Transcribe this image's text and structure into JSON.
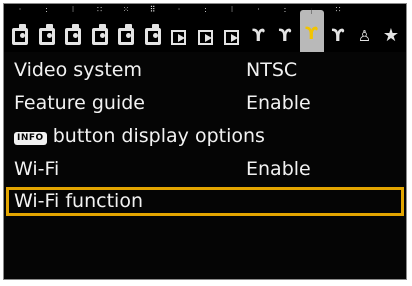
{
  "tabs": [
    {
      "icon": "shooting-icon",
      "dots": "·",
      "kind": "cam",
      "glyph": ""
    },
    {
      "icon": "shooting-icon",
      "dots": ":",
      "kind": "cam",
      "glyph": ""
    },
    {
      "icon": "shooting-icon",
      "dots": "⁝",
      "kind": "cam",
      "glyph": ""
    },
    {
      "icon": "shooting-icon",
      "dots": "∷",
      "kind": "cam",
      "glyph": ""
    },
    {
      "icon": "shooting-icon",
      "dots": "⁙",
      "kind": "cam",
      "glyph": ""
    },
    {
      "icon": "shooting-icon",
      "dots": "⠿",
      "kind": "cam",
      "glyph": ""
    },
    {
      "icon": "playback-icon",
      "dots": "·",
      "kind": "play",
      "glyph": ""
    },
    {
      "icon": "playback-icon",
      "dots": ":",
      "kind": "play",
      "glyph": ""
    },
    {
      "icon": "playback-icon",
      "dots": "⁝",
      "kind": "play",
      "glyph": ""
    },
    {
      "icon": "setup-icon",
      "dots": "·",
      "kind": "wrench",
      "glyph": "ϒ"
    },
    {
      "icon": "setup-icon",
      "dots": ":",
      "kind": "wrench",
      "glyph": "ϒ"
    },
    {
      "icon": "setup-icon",
      "dots": "⁝",
      "kind": "wrench",
      "glyph": "ϒ",
      "active": true
    },
    {
      "icon": "setup-icon",
      "dots": "∷",
      "kind": "wrench",
      "glyph": "ϒ"
    },
    {
      "icon": "custom-function-icon",
      "dots": "",
      "kind": "person",
      "glyph": "♙"
    },
    {
      "icon": "my-menu-icon",
      "dots": "",
      "kind": "mymenu",
      "glyph": "★"
    }
  ],
  "menu": {
    "rows": [
      {
        "label": "Video system",
        "value": "NTSC"
      },
      {
        "label": "Feature guide",
        "value": "Enable"
      },
      {
        "icon_label": "INFO",
        "label": " button display options",
        "value": ""
      },
      {
        "label": "Wi-Fi",
        "value": "Enable"
      },
      {
        "label": "Wi-Fi function",
        "value": "",
        "selected": true
      }
    ]
  },
  "colors": {
    "background": "#050505",
    "text": "#f2f2f2",
    "selection": "#e3a500",
    "active_tab_icon": "#f2c400"
  }
}
